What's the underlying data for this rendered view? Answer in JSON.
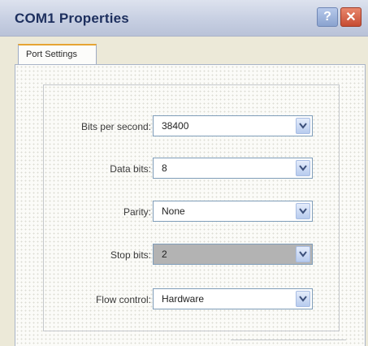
{
  "window": {
    "title": "COM1 Properties",
    "help_label": "?",
    "close_label": "✕"
  },
  "tabs": [
    {
      "label": "Port Settings",
      "active": true
    }
  ],
  "settings": [
    {
      "label": "Bits per second:",
      "value": "38400"
    },
    {
      "label": "Data bits:",
      "value": "8"
    },
    {
      "label": "Parity:",
      "value": "None"
    },
    {
      "label": "Stop bits:",
      "value": "2",
      "focused": true
    },
    {
      "label": "Flow control:",
      "value": "Hardware"
    }
  ],
  "colors": {
    "title_text": "#1d2f5e",
    "combo_border": "#7f9db9",
    "selected_combo": "#b3b3b3",
    "close_button": "#c64c33"
  },
  "icons": {
    "help": "help-icon",
    "close": "close-icon",
    "dropdown": "chevron-down-icon"
  }
}
